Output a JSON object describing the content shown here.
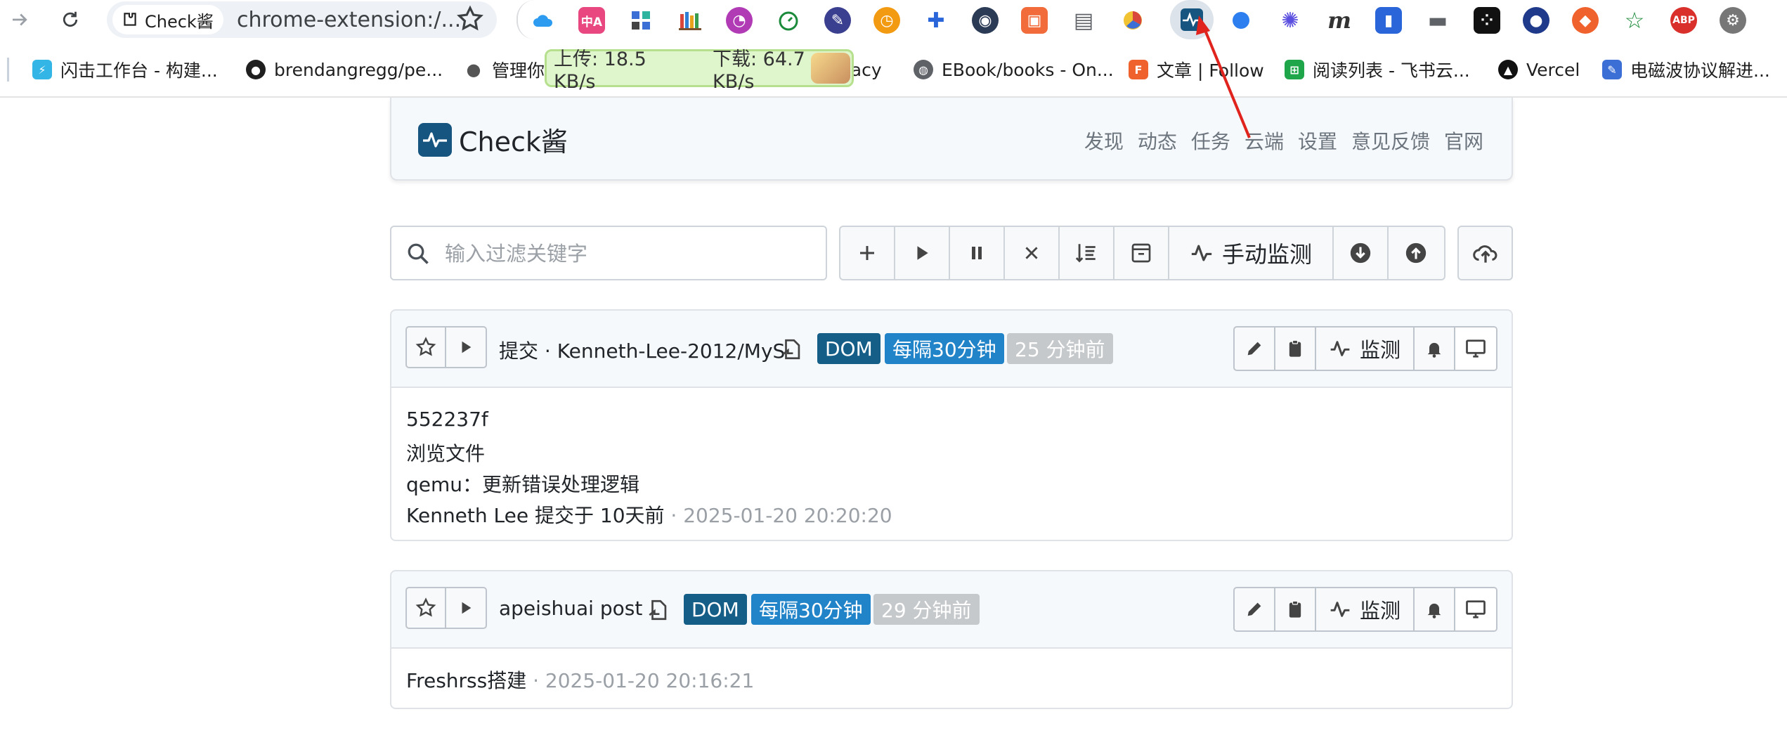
{
  "browser": {
    "site_chip_label": "Check酱",
    "url": "chrome-extension:/...",
    "extensions": [
      "cloud-icon",
      "translate-icon",
      "apps-grid-icon",
      "bookshelf-icon",
      "chat-bubble-icon",
      "timer-icon",
      "palette-icon",
      "clock-icon",
      "puzzle-icon",
      "fox-icon",
      "reader-icon",
      "archive-icon",
      "pie-icon",
      "check-chan-icon",
      "dot-icon",
      "sparkle-icon",
      "m-icon",
      "bookmark-icon",
      "folder-icon",
      "dice-icon",
      "shield-icon",
      "bulb-icon",
      "star-icon",
      "abp-icon",
      "gear-profile-icon"
    ],
    "bookmarks": [
      {
        "label": "闪击工作台 - 构建...",
        "icon": "lightning-icon"
      },
      {
        "label": "brendangregg/pe...",
        "icon": "github-icon"
      },
      {
        "label": "管理你",
        "icon": "apple-icon"
      },
      {
        "label": "yacy",
        "icon": "cube-icon"
      },
      {
        "label": "EBook/books - On...",
        "icon": "globe-icon"
      },
      {
        "label": "文章 | Follow",
        "icon": "follow-icon"
      },
      {
        "label": "阅读列表 - 飞书云...",
        "icon": "sheet-icon"
      },
      {
        "label": "Vercel",
        "icon": "vercel-icon"
      },
      {
        "label": "电磁波协议解进...",
        "icon": "note-icon"
      }
    ],
    "speed": {
      "upload": "上传: 18.5 KB/s",
      "download": "下载: 64.7 KB/s"
    }
  },
  "app": {
    "brand": "Check酱",
    "nav": [
      "发现",
      "动态",
      "任务",
      "云端",
      "设置",
      "意见反馈",
      "官网"
    ]
  },
  "toolbar": {
    "search_placeholder": "输入过滤关键字",
    "manual_check_label": "手动监测"
  },
  "tasks": [
    {
      "title": "提交 · Kenneth-Lee-2012/MyS",
      "type_badge": "DOM",
      "interval_badge": "每隔30分钟",
      "time_badge": "25 分钟前",
      "check_label": "监测",
      "lines": [
        "552237f",
        "浏览文件",
        "qemu：更新错误处理逻辑"
      ],
      "footer_text": "Kenneth Lee 提交于 10天前",
      "footer_time": " · 2025-01-20 20:20:20"
    },
    {
      "title": "apeishuai post",
      "type_badge": "DOM",
      "interval_badge": "每隔30分钟",
      "time_badge": "29 分钟前",
      "check_label": "监测",
      "lines": [],
      "footer_text": "Freshrss搭建",
      "footer_time": " · 2025-01-20 20:16:21"
    }
  ],
  "colors": {
    "accent": "#16557f",
    "dom_badge": "#155e88",
    "interval_badge": "#2183c8",
    "time_badge": "#c6c9cc",
    "annotation": "#e0231c"
  }
}
